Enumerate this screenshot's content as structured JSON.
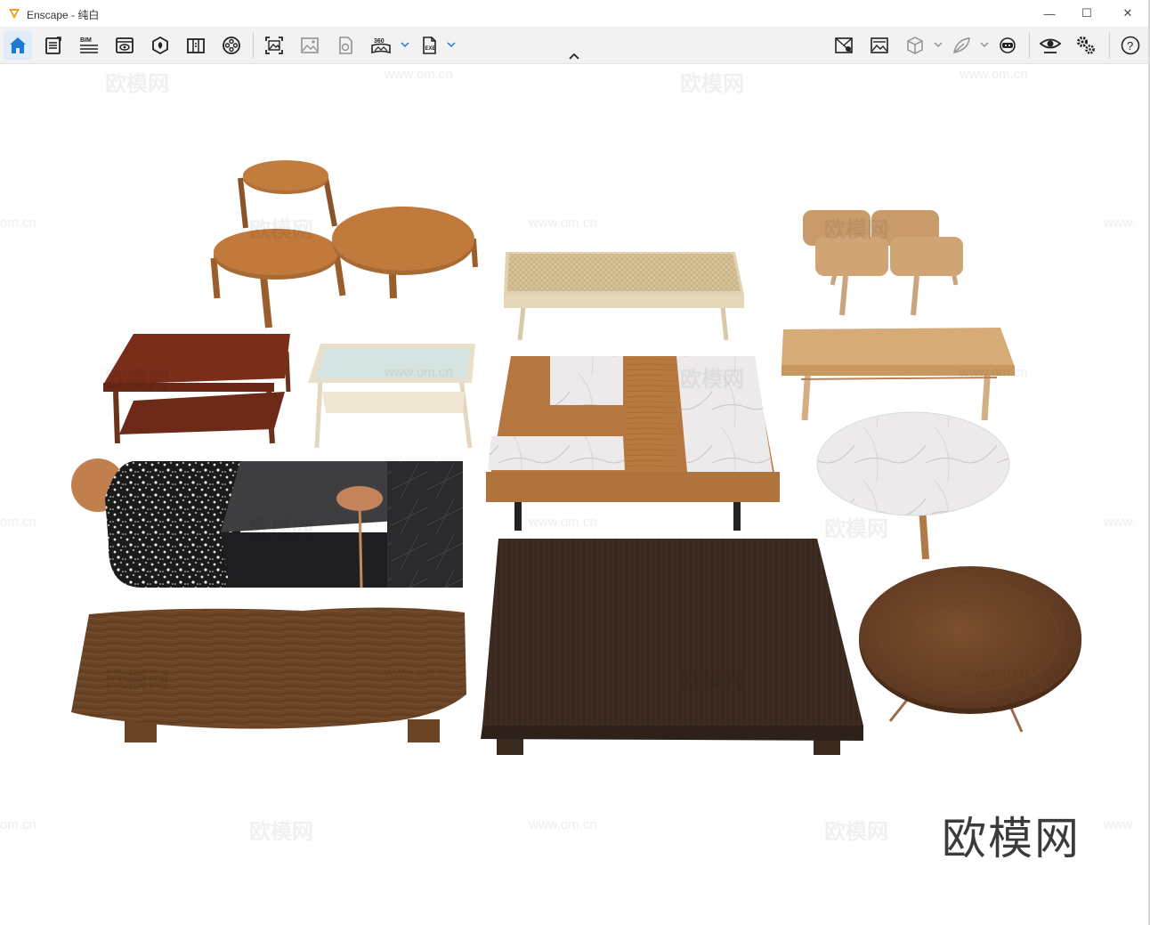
{
  "window": {
    "title": "Enscape - 纯白",
    "controls": {
      "minimize": "—",
      "maximize": "☐",
      "close": "✕"
    }
  },
  "toolbar": {
    "left_icons": [
      "home-icon",
      "file-icon",
      "bim-icon",
      "view-icon",
      "asset-icon",
      "library-icon",
      "material-icon"
    ],
    "capture_icons": [
      "screenshot-icon",
      "batch-render-icon",
      "panorama-upload-icon",
      "360-panorama-icon",
      "exe-export-icon"
    ],
    "bim_label": "BIM",
    "pano_label": "360",
    "exe_label": "EXE",
    "right_icons": [
      "site-context-icon",
      "atmosphere-icon",
      "cube-icon",
      "vegetation-icon",
      "vr-headset-icon",
      "visual-settings-icon",
      "general-settings-icon",
      "help-icon"
    ],
    "help_label": "?",
    "accent": "#1e7ad6"
  },
  "watermarks": {
    "text": "欧模网",
    "url": "www.om.cn",
    "url_partial_left": "om.cn",
    "url_partial_right": "www."
  },
  "brand": {
    "text": "欧模网"
  }
}
